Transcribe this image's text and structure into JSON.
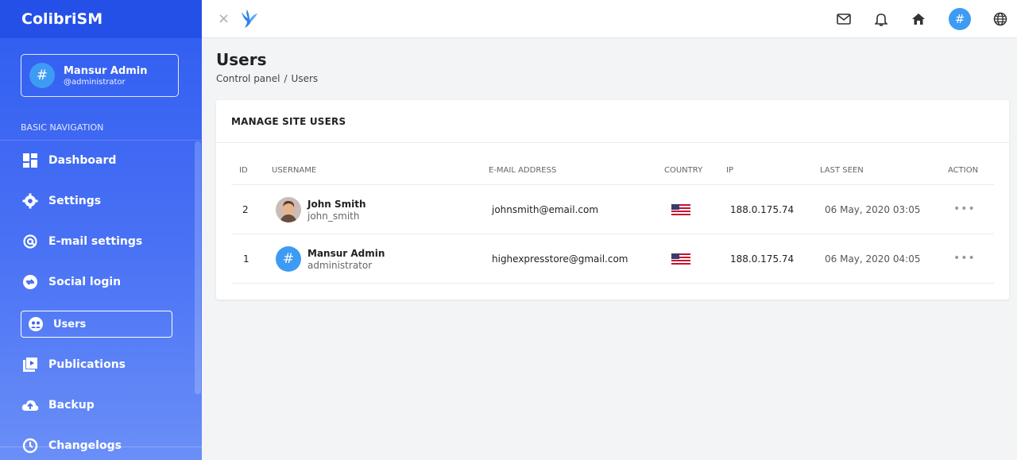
{
  "app": {
    "brand": "ColibriSM"
  },
  "sidebar": {
    "user": {
      "name": "Mansur Admin",
      "handle": "@administrator",
      "avatar_symbol": "#"
    },
    "heading": "BASIC NAVIGATION",
    "items": [
      {
        "label": "Dashboard",
        "icon": "dashboard-icon"
      },
      {
        "label": "Settings",
        "icon": "gear-icon"
      },
      {
        "label": "E-mail settings",
        "icon": "at-icon"
      },
      {
        "label": "Social login",
        "icon": "social-login-icon"
      },
      {
        "label": "Users",
        "icon": "users-icon",
        "active": true
      },
      {
        "label": "Publications",
        "icon": "publications-icon"
      },
      {
        "label": "Backup",
        "icon": "cloud-upload-icon"
      },
      {
        "label": "Changelogs",
        "icon": "changelogs-icon"
      }
    ]
  },
  "topbar": {
    "close_symbol": "×",
    "avatar_symbol": "#",
    "icons": [
      "mail-icon",
      "bell-icon",
      "home-icon",
      "avatar",
      "globe-icon"
    ]
  },
  "page": {
    "title": "Users",
    "breadcrumb": [
      "Control panel",
      "Users"
    ],
    "breadcrumb_sep": "/"
  },
  "card": {
    "title": "MANAGE SITE USERS",
    "columns": [
      "ID",
      "USERNAME",
      "E-MAIL ADDRESS",
      "COUNTRY",
      "IP",
      "LAST SEEN",
      "ACTION"
    ],
    "rows": [
      {
        "id": "2",
        "name": "John Smith",
        "username": "john_smith",
        "email": "johnsmith@email.com",
        "country": "us-flag",
        "ip": "188.0.175.74",
        "last_seen": "06 May, 2020 03:05",
        "action": "•••"
      },
      {
        "id": "1",
        "name": "Mansur Admin",
        "username": "administrator",
        "email": "highexpresstore@gmail.com",
        "country": "us-flag",
        "ip": "188.0.175.74",
        "last_seen": "06 May, 2020 04:05",
        "action": "•••",
        "avatar_symbol": "#"
      }
    ]
  },
  "colors": {
    "sidebar": "#2f5cf0",
    "accent": "#3d9bf3",
    "background": "#f3f4f6"
  }
}
